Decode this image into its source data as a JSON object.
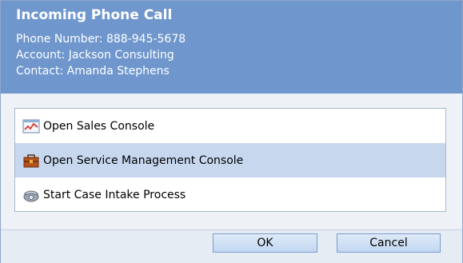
{
  "dialog": {
    "title": "Incoming Phone Call",
    "phone_number": "Phone Number: 888-945-5678",
    "account": "Account: Jackson Consulting",
    "contact": "Contact: Amanda Stephens"
  },
  "options": [
    {
      "label": "Open Sales Console",
      "icon": "chart-icon",
      "selected": false
    },
    {
      "label": "Open Service Management Console",
      "icon": "toolbox-icon",
      "selected": true
    },
    {
      "label": "Start Case Intake Process",
      "icon": "phone-icon",
      "selected": false
    }
  ],
  "buttons": {
    "ok_label": "OK",
    "cancel_label": "Cancel"
  },
  "colors": {
    "header_bg": "#6f97cd",
    "selected_bg": "#c7d8ee",
    "panel_border": "#a9b8cb"
  }
}
